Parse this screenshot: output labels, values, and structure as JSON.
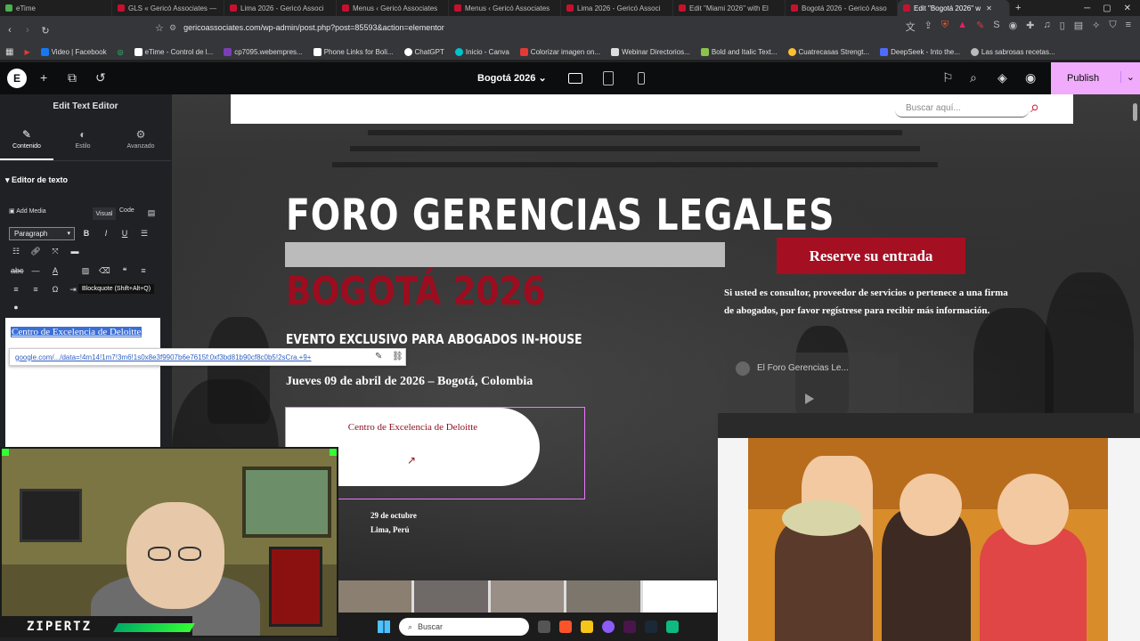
{
  "browser": {
    "tabs": [
      {
        "label": "eTime",
        "color": "#4caf50"
      },
      {
        "label": "GLS « Gericó Associates —",
        "color": "#c8102e"
      },
      {
        "label": "Lima 2026 - Gericó Associ",
        "color": "#c8102e"
      },
      {
        "label": "Menus ‹ Gericó Associates",
        "color": "#c8102e"
      },
      {
        "label": "Menus ‹ Gericó Associates",
        "color": "#c8102e"
      },
      {
        "label": "Lima 2026 - Gericó Associ",
        "color": "#c8102e"
      },
      {
        "label": "Edit \"Miami 2026\" with El",
        "color": "#c8102e"
      },
      {
        "label": "Bogotá 2026 - Gericó Asso",
        "color": "#c8102e"
      },
      {
        "label": "Edit \"Bogotá 2026\" w",
        "color": "#c8102e",
        "active": true
      }
    ],
    "url": "gericoassociates.com/wp-admin/post.php?post=85593&action=elementor",
    "bookmarks": [
      {
        "label": "Video | Facebook",
        "color": "#1877f2"
      },
      {
        "label": "eTime - Control de l...",
        "color": "#fff"
      },
      {
        "label": "cp7095.webempres...",
        "color": "#7b3fb5"
      },
      {
        "label": "Phone Links for Boli...",
        "color": "#fff"
      },
      {
        "label": "ChatGPT",
        "color": "#fff"
      },
      {
        "label": "Inicio - Canva",
        "color": "#00c4cc"
      },
      {
        "label": "Colorizar imagen on...",
        "color": "#e53935"
      },
      {
        "label": "Webinar Directorios...",
        "color": "#ddd"
      },
      {
        "label": "Bold and Italic Text...",
        "color": "#8bc34a"
      },
      {
        "label": "Cuatrecasas Strengt...",
        "color": "#fbc02d"
      },
      {
        "label": "DeepSeek - Into the...",
        "color": "#4d6bfe"
      },
      {
        "label": "Las sabrosas recetas...",
        "color": "#bbb"
      }
    ]
  },
  "elementor": {
    "page_title": "Bogotá 2026",
    "publish_label": "Publish",
    "panel": {
      "title": "Edit Text Editor",
      "tabs": [
        {
          "label": "Contenido",
          "icon": "pencil-icon"
        },
        {
          "label": "Estilo",
          "icon": "contrast-icon"
        },
        {
          "label": "Avanzado",
          "icon": "gear-icon"
        }
      ],
      "section": "Editor de texto",
      "add_media": "Add Media",
      "visual": "Visual",
      "code": "Code",
      "paragraph": "Paragraph",
      "tooltip": "Blockquote (Shift+Alt+Q)",
      "selected_text": "Centro de Excelencia de Deloitte",
      "link_url": "google.com/.../data=!4m14!1m7!3m6!1s0x8e3f9907b6e7615f:0xf3bd81b90cf8c0b5!2sCra.+9+"
    }
  },
  "hero": {
    "search_placeholder": "Buscar aquí...",
    "title_line1": "FORO GERENCIAS LEGALES",
    "title_line2": "BOGOTÁ 2026",
    "subtitle": "EVENTO EXCLUSIVO PARA ABOGADOS IN-HOUSE",
    "date": "Jueves 09 de abril de 2026 – Bogotá, Colombia",
    "venue": "Centro de Excelencia de Deloitte",
    "venue_arrow": "↗",
    "date2_line1": "29 de octubre",
    "date2_line2": "Lima, Perú",
    "reserve": "Reserve su entrada",
    "intro": "Si usted es consultor, proveedor de servicios o pertenece a una firma de abogados, por favor regístrese para recibir más información.",
    "video_title": "El Foro Gerencias Le..."
  },
  "overlay": {
    "streamer_name": "ZIPERTZ",
    "taskbar_search": "Buscar"
  },
  "colors": {
    "accent_red": "#a50f22",
    "elementor_pink": "#f0abfc",
    "selection_blue": "#3b6fd6"
  }
}
